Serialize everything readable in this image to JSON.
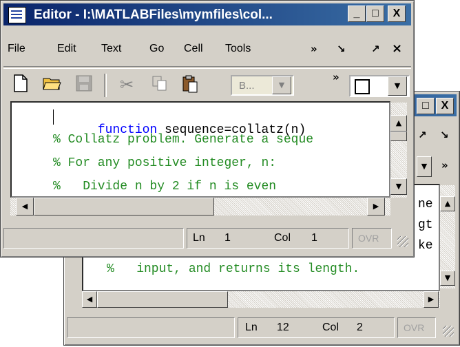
{
  "front": {
    "title": "Editor - I:\\MATLABFiles\\mymfiles\\col...",
    "title_buttons": [
      "_",
      "□",
      "X"
    ],
    "menu": [
      "File",
      "Edit",
      "Text",
      "Go",
      "Cell",
      "Tools"
    ],
    "menu_right": [
      "»",
      "↘",
      "↗",
      "×"
    ],
    "toolbar": {
      "combo_text": "B...",
      "overflow": "»"
    },
    "code": [
      [
        {
          "t": "kw",
          "s": "function"
        },
        {
          "t": "plain",
          "s": " sequence=collatz(n)"
        }
      ],
      [
        {
          "t": "cm",
          "s": "% Collatz problem. Generate a seque"
        }
      ],
      [
        {
          "t": "cm",
          "s": "% For any positive integer, n:"
        }
      ],
      [
        {
          "t": "cm",
          "s": "%   Divide n by 2 if n is even"
        }
      ]
    ],
    "status": {
      "ln_label": "Ln",
      "ln": "1",
      "col_label": "Col",
      "col": "1",
      "ovr": "OVR"
    }
  },
  "back": {
    "title_buttons": [
      "□",
      "X"
    ],
    "menu_right": [
      "↗",
      "↘"
    ],
    "overflow": "»",
    "code_fragments": [
      "ne",
      "gt",
      "ke"
    ],
    "code_line": "%   input, and returns its length.",
    "status": {
      "ln_label": "Ln",
      "ln": "12",
      "col_label": "Col",
      "col": "2",
      "ovr": "OVR"
    }
  },
  "arrows": {
    "up": "▲",
    "down": "▼",
    "left": "◀",
    "right": "▶"
  }
}
